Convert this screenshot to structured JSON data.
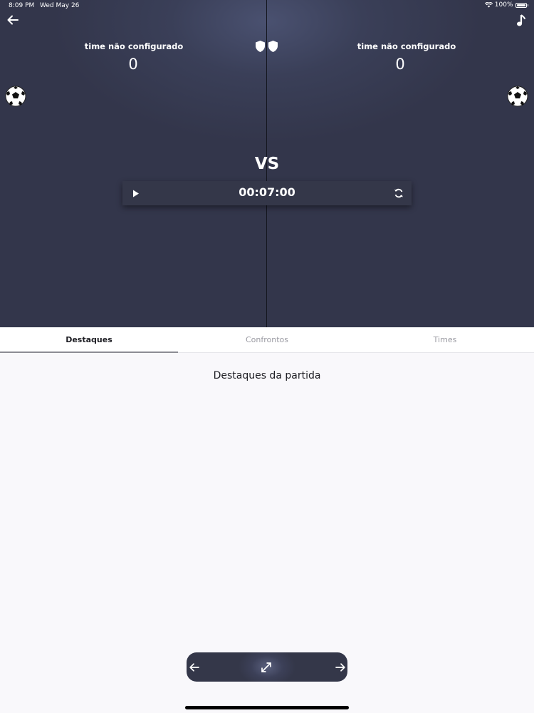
{
  "status_bar": {
    "time": "8:09 PM",
    "date": "Wed May 26",
    "battery": "100%"
  },
  "header": {
    "back_icon": "arrow-left-icon",
    "music_icon": "music-note-icon"
  },
  "match": {
    "home_team": {
      "name": "time não configurado",
      "score": "0"
    },
    "away_team": {
      "name": "time não configurado",
      "score": "0"
    },
    "vs_label": "VS",
    "timer": "00:07:00"
  },
  "tabs": [
    {
      "label": "Destaques",
      "active": true
    },
    {
      "label": "Confrontos",
      "active": false
    },
    {
      "label": "Times",
      "active": false
    }
  ],
  "content": {
    "title": "Destaques da partida"
  },
  "bottom_nav": {
    "prev_icon": "arrow-left-icon",
    "expand_icon": "expand-icon",
    "next_icon": "arrow-right-icon"
  },
  "colors": {
    "scoreboard_bg": "#33364b",
    "accent_white": "#ffffff",
    "page_bg": "#f9f8fb"
  }
}
